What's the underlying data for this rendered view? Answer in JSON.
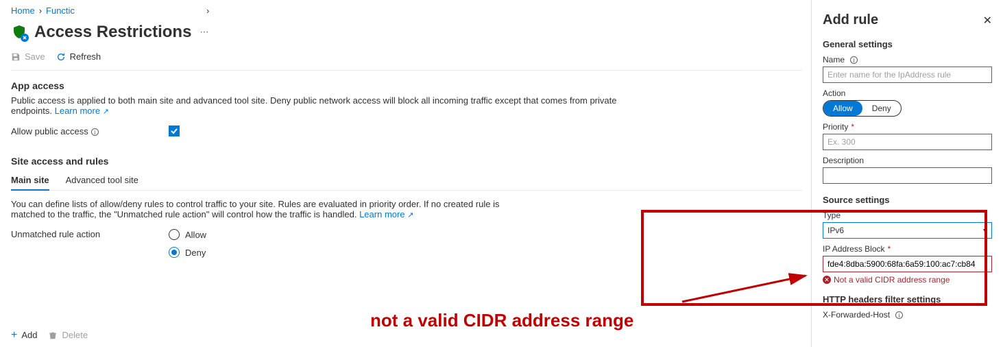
{
  "breadcrumb": {
    "home": "Home",
    "second": "Functic"
  },
  "page_title": "Access Restrictions",
  "toolbar": {
    "save": "Save",
    "refresh": "Refresh"
  },
  "app_access": {
    "title": "App access",
    "desc_prefix": "Public access is applied to both main site and advanced tool site. Deny public network access will block all incoming traffic except that comes from private endpoints. ",
    "learn_more": "Learn more",
    "allow_label": "Allow public access"
  },
  "site_rules": {
    "title": "Site access and rules",
    "tab_main": "Main site",
    "tab_adv": "Advanced tool site",
    "desc_prefix": "You can define lists of allow/deny rules to control traffic to your site. Rules are evaluated in priority order. If no created rule is matched to the traffic, the \"Unmatched rule action\" will control how the traffic is handled. ",
    "learn_more": "Learn more",
    "unmatched_label": "Unmatched rule action",
    "opt_allow": "Allow",
    "opt_deny": "Deny"
  },
  "bottom": {
    "add": "Add",
    "delete": "Delete"
  },
  "panel": {
    "title": "Add rule",
    "general": "General settings",
    "name_label": "Name",
    "name_placeholder": "Enter name for the IpAddress rule",
    "action_label": "Action",
    "action_allow": "Allow",
    "action_deny": "Deny",
    "priority_label": "Priority",
    "priority_placeholder": "Ex. 300",
    "desc_label": "Description",
    "source": "Source settings",
    "type_label": "Type",
    "type_value": "IPv6",
    "ip_label": "IP Address Block",
    "ip_value": "fde4:8dba:5900:68fa:6a59:100:ac7:cb84",
    "ip_error": "Not a valid CIDR address range",
    "http": "HTTP headers filter settings",
    "xfh_label": "X-Forwarded-Host"
  },
  "annotation_text": "not a valid CIDR address range"
}
